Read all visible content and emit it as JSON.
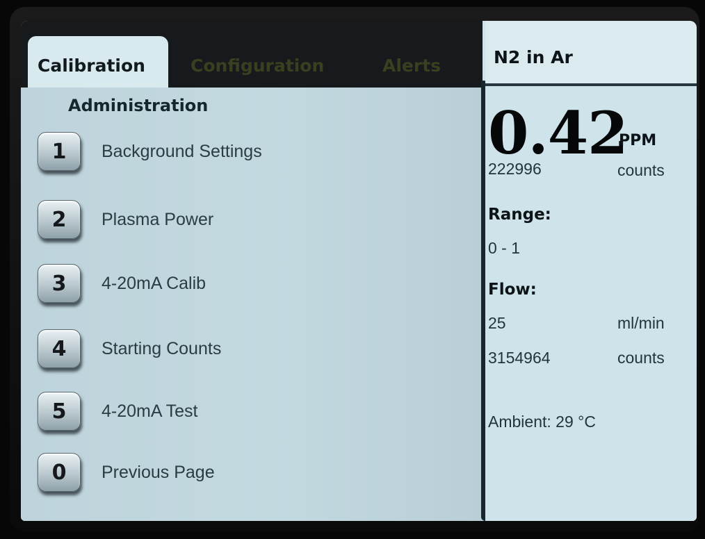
{
  "tabs": {
    "calibration": "Calibration",
    "configuration": "Configuration",
    "alerts": "Alerts"
  },
  "gas": "N2 in Ar",
  "section_title": "Administration",
  "menu": [
    {
      "key": "1",
      "label": "Background Settings"
    },
    {
      "key": "2",
      "label": "Plasma Power"
    },
    {
      "key": "3",
      "label": "4-20mA Calib"
    },
    {
      "key": "4",
      "label": "Starting Counts"
    },
    {
      "key": "5",
      "label": "4-20mA Test"
    },
    {
      "key": "0",
      "label": "Previous Page"
    }
  ],
  "reading": {
    "value": "0.42",
    "unit": "PPM",
    "counts": "222996",
    "counts_label": "counts"
  },
  "range": {
    "label": "Range:",
    "value": "0 - 1"
  },
  "flow": {
    "label": "Flow:",
    "value": "25",
    "unit": "ml/min",
    "counts": "3154964",
    "counts_label": "counts"
  },
  "ambient": "Ambient: 29 °C",
  "colors": {
    "screen_bg": "#cfe4ea",
    "tabstrip": "#161a1c",
    "text_dark": "#0d1418",
    "menu_text": "#2a3c44"
  }
}
